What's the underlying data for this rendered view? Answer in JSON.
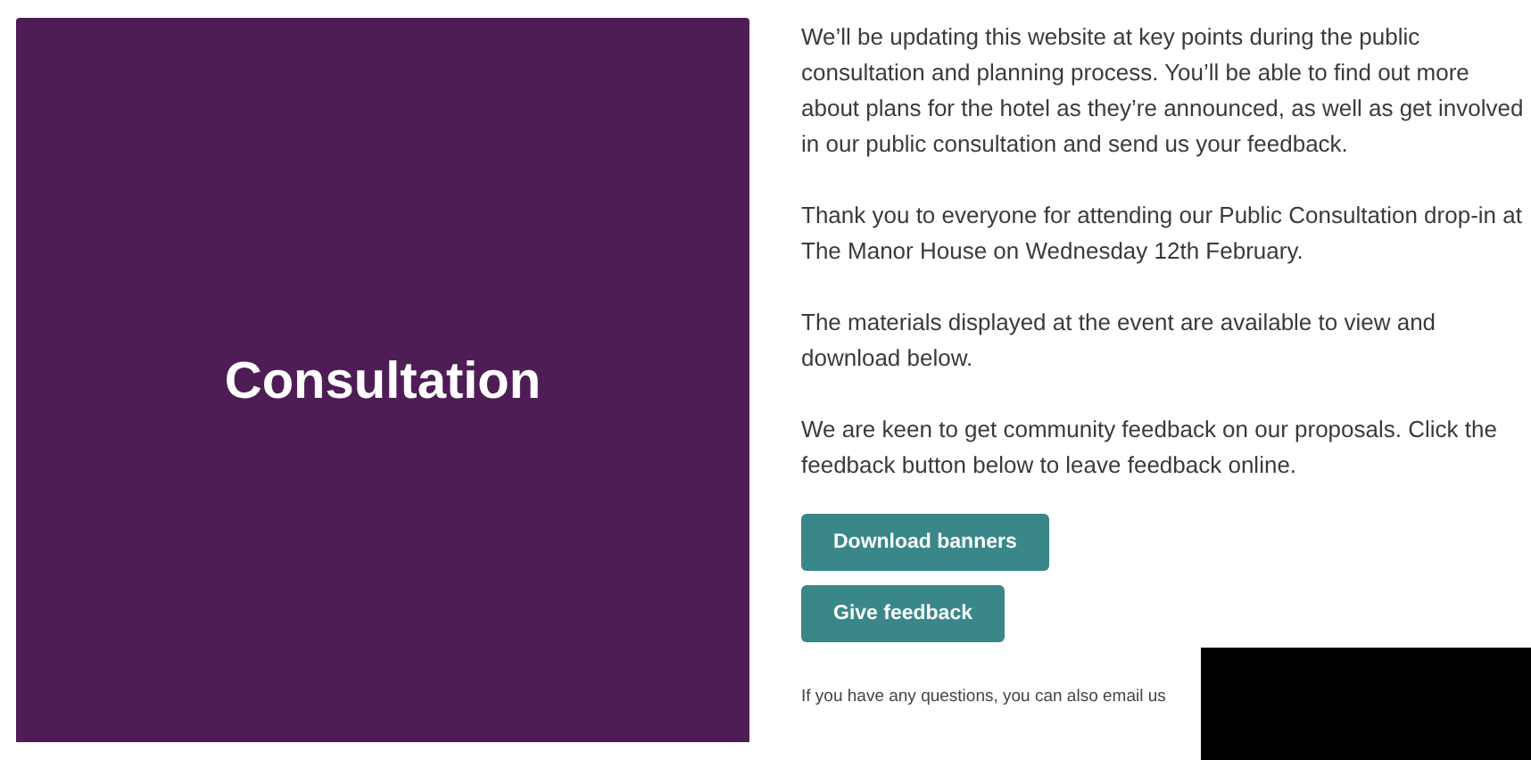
{
  "hero": {
    "title": "Consultation"
  },
  "paragraphs": [
    "We’ll be updating this website at key points during the public consultation and planning process. You’ll be able to find out more about plans for the hotel as they’re announced, as well as get involved in our public consultation and send us your feedback.",
    "Thank you to everyone for attending our Public Consultation drop-in at The Manor House on Wednesday 12th February.",
    "The materials displayed at the event are available to view and download below.",
    "We are keen to get community feedback on our proposals. Click the feedback button below to leave feedback online."
  ],
  "buttons": [
    "Download banners",
    "Give feedback"
  ],
  "note": "If you have any questions, you can also email us"
}
